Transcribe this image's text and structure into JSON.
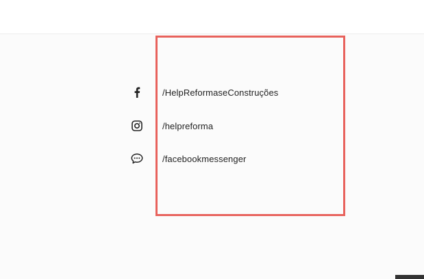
{
  "social_links": [
    {
      "icon": "facebook-icon",
      "label": "/HelpReformaseConstruções"
    },
    {
      "icon": "instagram-icon",
      "label": "/helpreforma"
    },
    {
      "icon": "messenger-icon",
      "label": "/facebookmessenger"
    }
  ],
  "colors": {
    "highlight_border": "#e8625c",
    "page_background": "#fbfbfb",
    "header_background": "#ffffff",
    "text": "#222222"
  }
}
